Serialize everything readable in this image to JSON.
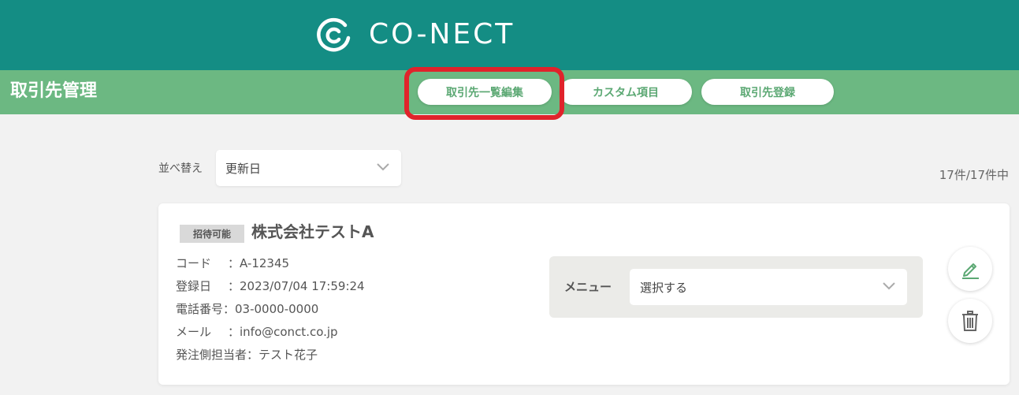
{
  "header": {
    "logo_text": "CO-NECT",
    "logo_icon": "conect-logo-icon",
    "bg_color": "#148d84"
  },
  "subbar": {
    "title": "取引先管理",
    "bg_color": "#6cb882",
    "tabs": [
      {
        "label": "取引先一覧編集",
        "highlighted": true
      },
      {
        "label": "カスタム項目"
      },
      {
        "label": "取引先登録"
      }
    ]
  },
  "toolbar": {
    "sort_label": "並べ替え",
    "sort_value": "更新日",
    "count_text": "17件/17件中"
  },
  "card": {
    "badge": "招待可能",
    "company": "株式会社テストA",
    "rows": [
      {
        "key": "コード",
        "value": "：A-12345"
      },
      {
        "key": "登録日",
        "value": "：2023/07/04 17:59:24"
      },
      {
        "key": "電話番号",
        "value": "：03-0000-0000"
      },
      {
        "key": "メール",
        "value": "：info@conct.co.jp"
      },
      {
        "key": "発注側担当者",
        "value": "：テスト花子"
      }
    ],
    "menu_label": "メニュー",
    "menu_value": "選択する",
    "edit_icon": "pencil-icon",
    "delete_icon": "trash-icon"
  },
  "colors": {
    "accent_green": "#5ba873",
    "highlight_red": "#e0232b"
  }
}
